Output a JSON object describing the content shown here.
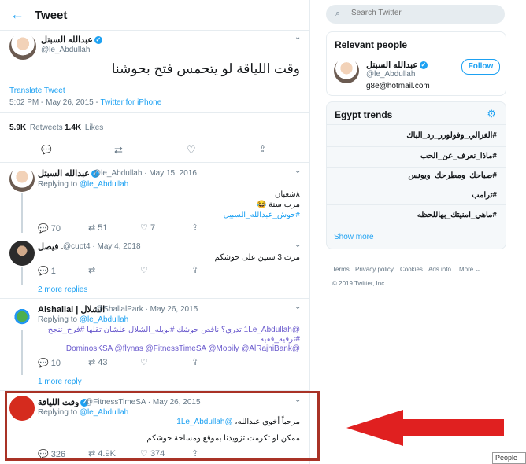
{
  "header": {
    "back_icon": "arrow-left-icon",
    "title": "Tweet"
  },
  "main_tweet": {
    "name": "عبدالله السبتل",
    "handle": "@le_Abdullah",
    "text": "وقت اللياقة لو يتحمس فتح بحوشنا",
    "translate": "Translate Tweet",
    "time": "5:02 PM - May 26, 2015",
    "source": "Twitter for iPhone",
    "retweets_count": "5.9K",
    "retweets_label": "Retweets",
    "likes_count": "1.4K",
    "likes_label": "Likes"
  },
  "replies": [
    {
      "name": "عبدالله السبتل",
      "handle": "@le_Abdullah",
      "date": "May 15, 2016",
      "replying_label": "Replying to",
      "replying_to": "@le_Abdullah",
      "line1": "٨شعبان",
      "line2": "مرت سنة 😂",
      "line3": "#حوش_عبدالله_السبيل",
      "replies": "70",
      "retweets": "51",
      "likes": "7"
    },
    {
      "name": "فيصل .",
      "handle": "@cuot4",
      "date": "May 4, 2018",
      "text": "مرت 3 سنين على حوشكم",
      "replies": "1",
      "more_replies": "2 more replies"
    },
    {
      "name": "Alshallal | الشلال",
      "handle": "@ShallalPark",
      "date": "May 26, 2015",
      "replying_label": "Replying to",
      "replying_to": "@le_Abdullah",
      "line1": "@1Le_Abdullah تدري؟ ناقص حوشك #نويله_الشلال علشان تقلها #فرح_تنجح",
      "line2": "#ترفيه_فقيه",
      "line3": "@DominosKSA @flynas @FitnessTimeSA @Mobily @AlRajhiBank",
      "replies": "10",
      "retweets": "43",
      "more_replies": "1 more reply"
    },
    {
      "name": "وقت اللياقة",
      "handle": "@FitnessTimeSA",
      "date": "May 26, 2015",
      "replying_label": "Replying to",
      "replying_to": "@le_Abdullah",
      "line1_mention": "@1Le_Abdullah",
      "line1_text": "مرحباً أخوي عبدالله،",
      "line2": "ممكن لو تكرمت تزويدنا بموقع ومساحة حوشكم",
      "replies": "326",
      "retweets": "4.9K",
      "likes": "374"
    }
  ],
  "search": {
    "placeholder": "Search Twitter"
  },
  "relevant": {
    "title": "Relevant people",
    "name": "عبدالله السبتل",
    "handle": "@le_Abdullah",
    "follow": "Follow",
    "bio": "g8e@hotmail.com"
  },
  "trends": {
    "title": "Egypt trends",
    "items": [
      "#الغزالي_وفولورر_رد_الباك",
      "#ماذا_نعرف_عن_الحب",
      "#صباحك_ومطرحك_ويونس",
      "#ترامب",
      "#ماهي_امنيتك_بهاللحظه"
    ],
    "show_more": "Show more"
  },
  "footer": {
    "links": [
      "Terms",
      "Privacy policy",
      "Cookies",
      "Ads info",
      "More ⌄"
    ],
    "copyright": "© 2019 Twitter, Inc."
  },
  "people_tab": "People",
  "colors": {
    "accent": "#1da1f2",
    "highlight_border": "#a93226",
    "arrow": "#e02020"
  }
}
